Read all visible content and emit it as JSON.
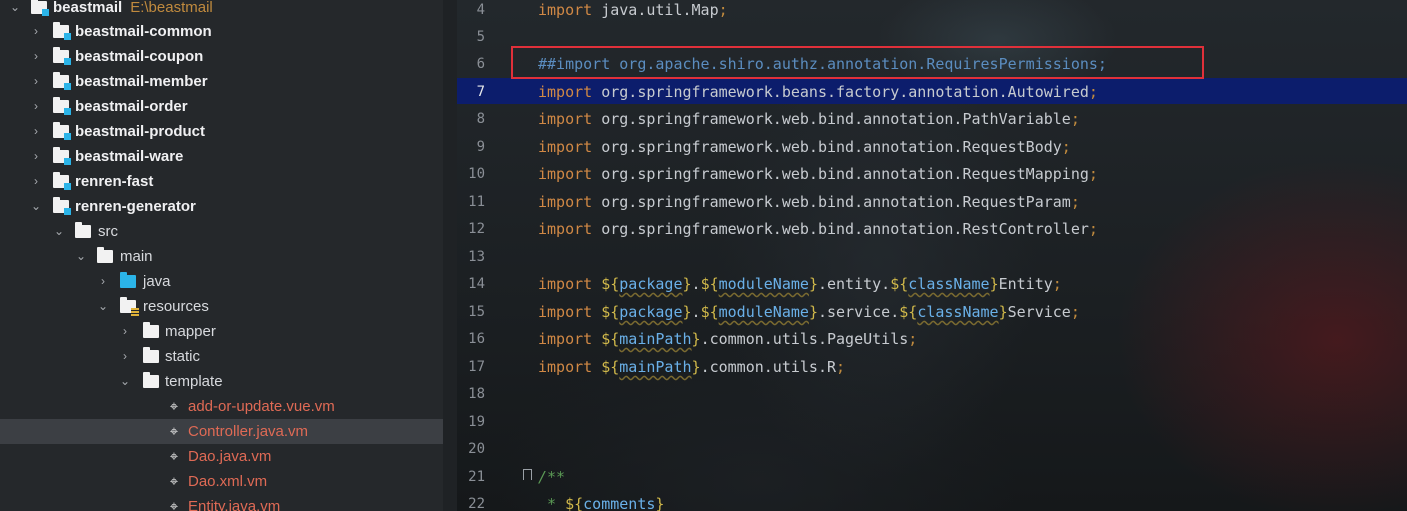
{
  "project_tree": {
    "root": {
      "label": "beastmail",
      "path": "E:\\beastmail"
    },
    "modules": [
      "beastmail-common",
      "beastmail-coupon",
      "beastmail-member",
      "beastmail-order",
      "beastmail-product",
      "beastmail-ware",
      "renren-fast",
      "renren-generator"
    ],
    "folders": {
      "src": "src",
      "main": "main",
      "java": "java",
      "resources": "resources",
      "mapper": "mapper",
      "static": "static",
      "template": "template"
    },
    "files": [
      "add-or-update.vue.vm",
      "Controller.java.vm",
      "Dao.java.vm",
      "Dao.xml.vm",
      "Entity.java.vm"
    ],
    "selected_file": "Controller.java.vm",
    "colors": {
      "file_text": "#df6a55",
      "module_text": "#f0f0f2",
      "selection": "#3c3f44"
    }
  },
  "editor": {
    "current_line": 7,
    "line_numbers": [
      "4",
      "5",
      "6",
      "7",
      "8",
      "9",
      "10",
      "11",
      "12",
      "13",
      "14",
      "15",
      "16",
      "17",
      "18",
      "19",
      "20",
      "21",
      "22"
    ],
    "lines": {
      "l4": {
        "kw": "import",
        "text": "java.util.Map",
        "punc": ";"
      },
      "l6": {
        "text": "##import org.apache.shiro.authz.annotation.RequiresPermissions;"
      },
      "l7": {
        "kw": "import",
        "text": "org.springframework.beans.factory.annotation.Autowired",
        "punc": ";"
      },
      "l8": {
        "kw": "import",
        "text": "org.springframework.web.bind.annotation.PathVariable",
        "punc": ";"
      },
      "l9": {
        "kw": "import",
        "text": "org.springframework.web.bind.annotation.RequestBody",
        "punc": ";"
      },
      "l10": {
        "kw": "import",
        "text": "org.springframework.web.bind.annotation.RequestMapping",
        "punc": ";"
      },
      "l11": {
        "kw": "import",
        "text": "org.springframework.web.bind.annotation.RequestParam",
        "punc": ";"
      },
      "l12": {
        "kw": "import",
        "text": "org.springframework.web.bind.annotation.RestController",
        "punc": ";"
      },
      "l14": {
        "kw": "import",
        "d1": "${",
        "v1": "package",
        "c1": "}",
        "t1": ".",
        "d2": "${",
        "v2": "moduleName",
        "c2": "}",
        "t2": ".entity.",
        "d3": "${",
        "v3": "className",
        "c3": "}",
        "t3": "Entity",
        "punc": ";"
      },
      "l15": {
        "kw": "import",
        "d1": "${",
        "v1": "package",
        "c1": "}",
        "t1": ".",
        "d2": "${",
        "v2": "moduleName",
        "c2": "}",
        "t2": ".service.",
        "d3": "${",
        "v3": "className",
        "c3": "}",
        "t3": "Service",
        "punc": ";"
      },
      "l16": {
        "kw": "import",
        "d1": "${",
        "v1": "mainPath",
        "c1": "}",
        "t1": ".common.utils.PageUtils",
        "punc": ";"
      },
      "l17": {
        "kw": "import",
        "d1": "${",
        "v1": "mainPath",
        "c1": "}",
        "t1": ".common.utils.R",
        "punc": ";"
      },
      "l21": {
        "text": "/**"
      },
      "l22": {
        "star": "*",
        "d1": "${",
        "v1": "comments",
        "c1": "}"
      }
    },
    "highlight_box_color": "#e0303a"
  }
}
